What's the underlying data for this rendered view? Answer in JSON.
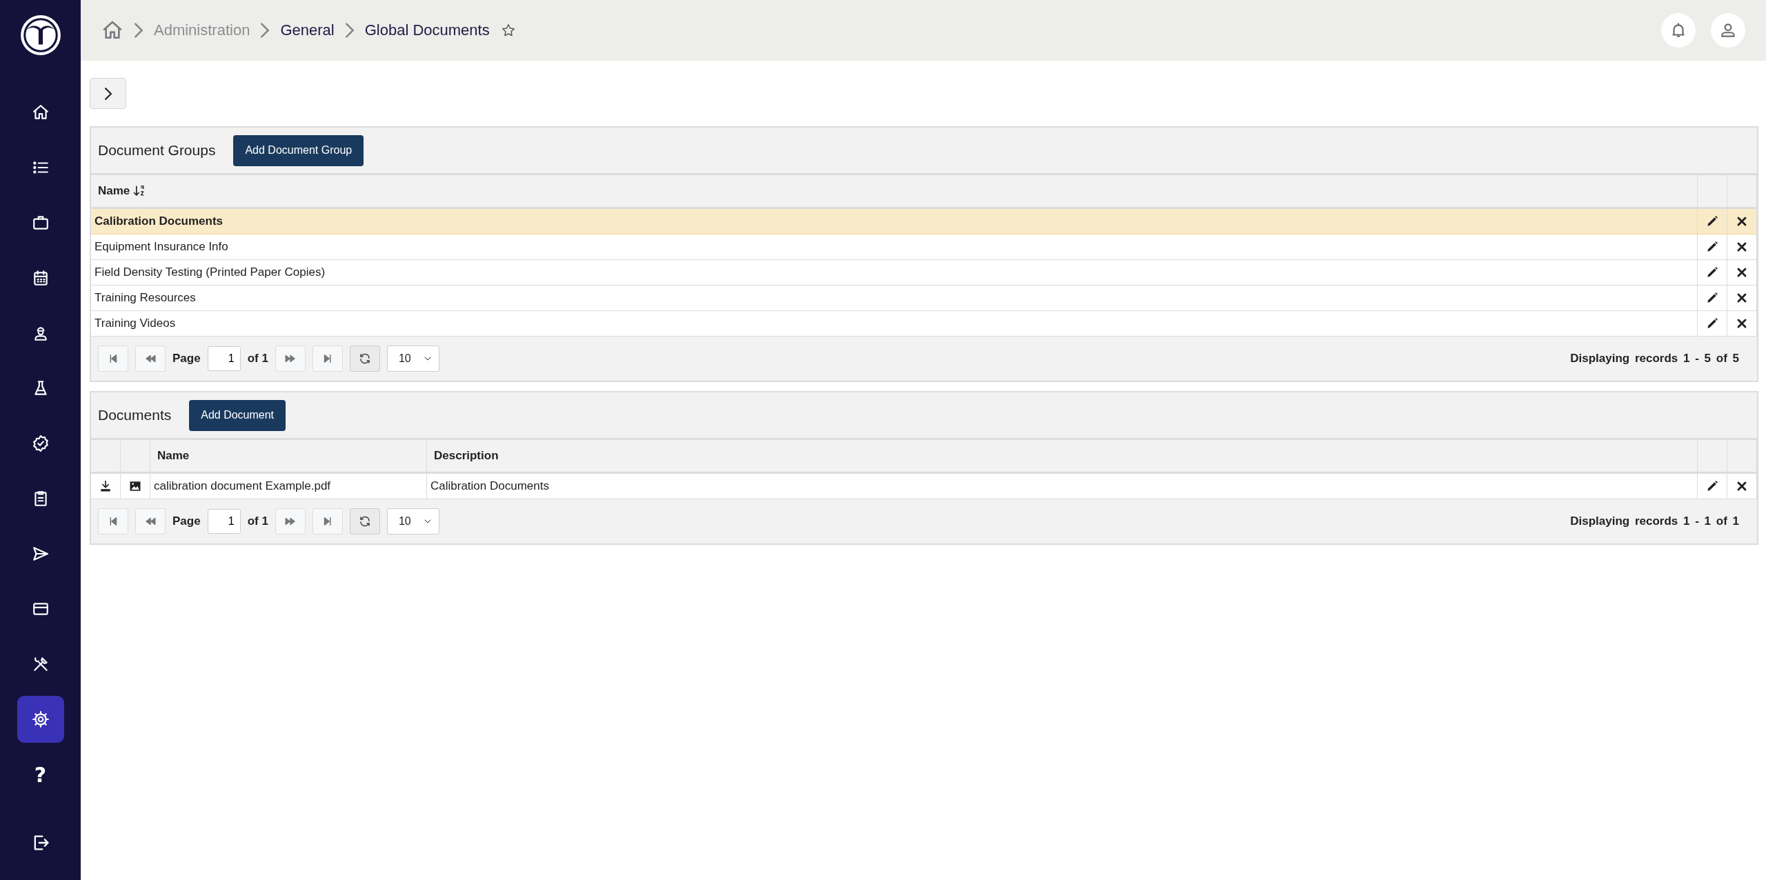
{
  "sidebar": {
    "items": [
      {
        "kind": "home",
        "selected": false
      },
      {
        "kind": "list",
        "selected": false
      },
      {
        "kind": "briefcase",
        "selected": false
      },
      {
        "kind": "calendar",
        "selected": false
      },
      {
        "kind": "worker",
        "selected": false
      },
      {
        "kind": "flask",
        "selected": false
      },
      {
        "kind": "verified",
        "selected": false
      },
      {
        "kind": "clipboard",
        "selected": false
      },
      {
        "kind": "send",
        "selected": false
      },
      {
        "kind": "card",
        "selected": false
      },
      {
        "kind": "tools",
        "selected": false
      },
      {
        "kind": "gear",
        "selected": true
      },
      {
        "kind": "text",
        "label": "?",
        "selected": false
      }
    ]
  },
  "breadcrumbs": [
    {
      "label": "Administration",
      "dimmed": true
    },
    {
      "label": "General",
      "dimmed": false
    },
    {
      "label": "Global Documents",
      "dimmed": false
    }
  ],
  "favorite": false,
  "document_groups": {
    "title": "Document Groups",
    "add_button": "Add Document Group",
    "columns": [
      {
        "label": "Name",
        "sorted": true
      }
    ],
    "rows": [
      {
        "name": "Calibration Documents",
        "selected": true
      },
      {
        "name": "Equipment Insurance Info",
        "selected": false
      },
      {
        "name": "Field Density Testing (Printed Paper Copies)",
        "selected": false
      },
      {
        "name": "Training Resources",
        "selected": false
      },
      {
        "name": "Training Videos",
        "selected": false
      }
    ],
    "pager": {
      "page_label": "Page",
      "page": "1",
      "of": "of 1",
      "page_size": "10",
      "summary": "Displaying records 1 - 5 of 5"
    }
  },
  "documents": {
    "title": "Documents",
    "add_button": "Add Document",
    "columns": [
      {
        "label": "Name"
      },
      {
        "label": "Description"
      }
    ],
    "rows": [
      {
        "name": "calibration document Example.pdf",
        "description": "Calibration Documents",
        "selected": false
      }
    ],
    "pager": {
      "page_label": "Page",
      "page": "1",
      "of": "of 1",
      "page_size": "10",
      "summary": "Displaying records 1 - 1 of 1"
    }
  }
}
